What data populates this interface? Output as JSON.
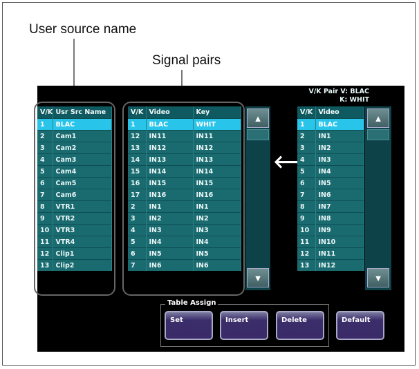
{
  "callouts": {
    "user_source_name": "User source name",
    "signal_pairs": "Signal pairs"
  },
  "source_list": {
    "headers": [
      "V/K",
      "Usr Src Name"
    ],
    "rows": [
      [
        "1",
        "BLAC"
      ],
      [
        "2",
        "Cam1"
      ],
      [
        "3",
        "Cam2"
      ],
      [
        "4",
        "Cam3"
      ],
      [
        "5",
        "Cam4"
      ],
      [
        "6",
        "Cam5"
      ],
      [
        "7",
        "Cam6"
      ],
      [
        "8",
        "VTR1"
      ],
      [
        "9",
        "VTR2"
      ],
      [
        "10",
        "VTR3"
      ],
      [
        "11",
        "VTR4"
      ],
      [
        "12",
        "Clip1"
      ],
      [
        "13",
        "Clip2"
      ]
    ],
    "selected_row": 0
  },
  "pairs_list": {
    "headers": [
      "V/K",
      "Video",
      "Key"
    ],
    "rows": [
      [
        "1",
        "BLAC",
        "WHIT"
      ],
      [
        "12",
        "IN11",
        "IN11"
      ],
      [
        "13",
        "IN12",
        "IN12"
      ],
      [
        "14",
        "IN13",
        "IN13"
      ],
      [
        "15",
        "IN14",
        "IN14"
      ],
      [
        "16",
        "IN15",
        "IN15"
      ],
      [
        "17",
        "IN16",
        "IN16"
      ],
      [
        "2",
        "IN1",
        "IN1"
      ],
      [
        "3",
        "IN2",
        "IN2"
      ],
      [
        "4",
        "IN3",
        "IN3"
      ],
      [
        "5",
        "IN4",
        "IN4"
      ],
      [
        "6",
        "IN5",
        "IN5"
      ],
      [
        "7",
        "IN6",
        "IN6"
      ]
    ],
    "selected_row": 0
  },
  "vk_pair": {
    "line1": "V/K Pair  V: BLAC",
    "line2": "K: WHIT"
  },
  "video_list": {
    "headers": [
      "V/K",
      "Video"
    ],
    "rows": [
      [
        "1",
        "BLAC"
      ],
      [
        "2",
        "IN1"
      ],
      [
        "3",
        "IN2"
      ],
      [
        "4",
        "IN3"
      ],
      [
        "5",
        "IN4"
      ],
      [
        "6",
        "IN5"
      ],
      [
        "7",
        "IN6"
      ],
      [
        "8",
        "IN7"
      ],
      [
        "9",
        "IN8"
      ],
      [
        "10",
        "IN9"
      ],
      [
        "11",
        "IN10"
      ],
      [
        "12",
        "IN11"
      ],
      [
        "13",
        "IN12"
      ]
    ],
    "selected_row": 0
  },
  "icons": {
    "scroll_up": "up-triangle-icon",
    "scroll_down": "down-triangle-icon",
    "assign_arrow": "left-arrow-icon"
  },
  "table_assign": {
    "title": "Table Assign",
    "buttons": {
      "set": "Set",
      "insert": "Insert",
      "delete": "Delete"
    }
  },
  "default_button": "Default",
  "colors": {
    "list_bg": "#1a6b70",
    "selected_row": "#29c4ea",
    "button_purple": "#3a2a68",
    "screen_bg": "#000000"
  }
}
